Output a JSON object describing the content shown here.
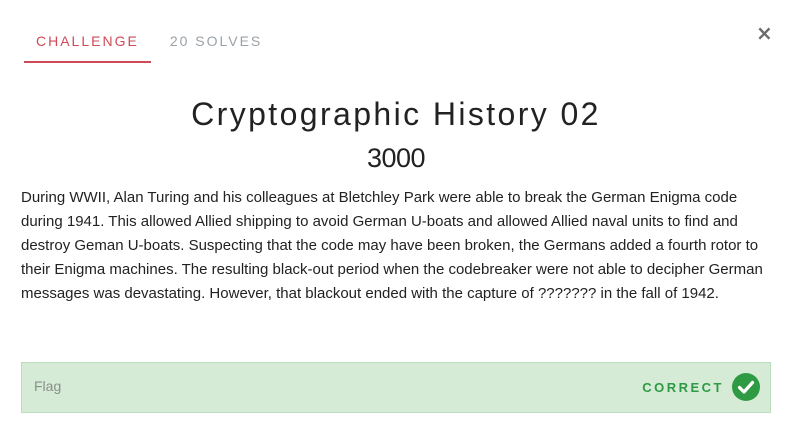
{
  "tabs": {
    "challenge": "CHALLENGE",
    "solves": "20 SOLVES"
  },
  "close_icon": "×",
  "challenge": {
    "title": "Cryptographic History 02",
    "points": "3000",
    "description": "During WWII, Alan Turing and his colleagues at Bletchley Park were able to break the German Enigma code during 1941. This allowed Allied shipping to avoid German U-boats and allowed Allied naval units to find and destroy Geman U-boats. Suspecting that the code may have been broken, the Germans added a fourth rotor to their Enigma machines. The resulting black-out period when the codebreaker were not able to decipher German messages was devastating. However, that blackout ended with the capture of ??????? in the fall of 1942."
  },
  "flag": {
    "placeholder": "Flag",
    "value": "",
    "status": "CORRECT",
    "status_icon": "check-circle-icon"
  },
  "colors": {
    "accent": "#cf4b57",
    "muted_tab": "#9aa2a8",
    "success": "#2e9a44",
    "success_bg": "#d5ebd6"
  }
}
